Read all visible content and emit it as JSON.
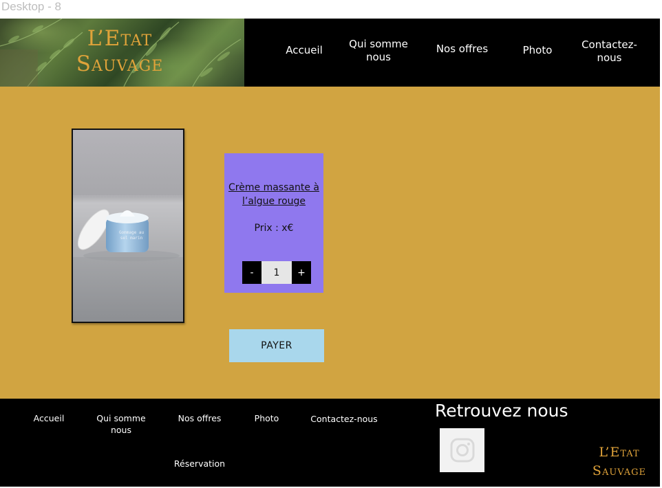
{
  "frame": {
    "title": "Desktop - 8"
  },
  "brand": {
    "line1": "L’Etat",
    "line2": "Sauvage"
  },
  "header": {
    "nav": [
      {
        "label": "Accueil"
      },
      {
        "label": "Qui somme nous"
      },
      {
        "label": "Nos offres"
      },
      {
        "label": "Photo"
      },
      {
        "label": "Contactez-nous"
      }
    ]
  },
  "product": {
    "jar_label": "Gommage au sel marin",
    "name": "Crème massante à l’algue rouge",
    "price": "Prix : x€",
    "quantity": {
      "decrement": "-",
      "value": "1",
      "increment": "+"
    }
  },
  "checkout": {
    "pay_label": "PAYER"
  },
  "footer": {
    "nav": [
      {
        "label": "Accueil"
      },
      {
        "label": "Qui somme nous"
      },
      {
        "label": "Nos offres"
      },
      {
        "label": "Photo"
      },
      {
        "label": "Contactez-nous"
      },
      {
        "label": "Réservation"
      }
    ],
    "find_us": "Retrouvez nous",
    "social_icon": "instagram-icon"
  },
  "colors": {
    "page_background": "#d1a441",
    "header_background": "#000000",
    "brand_gold": "#e0a33a",
    "product_card": "#8f78ee",
    "pay_button": "#a9d7ec"
  }
}
